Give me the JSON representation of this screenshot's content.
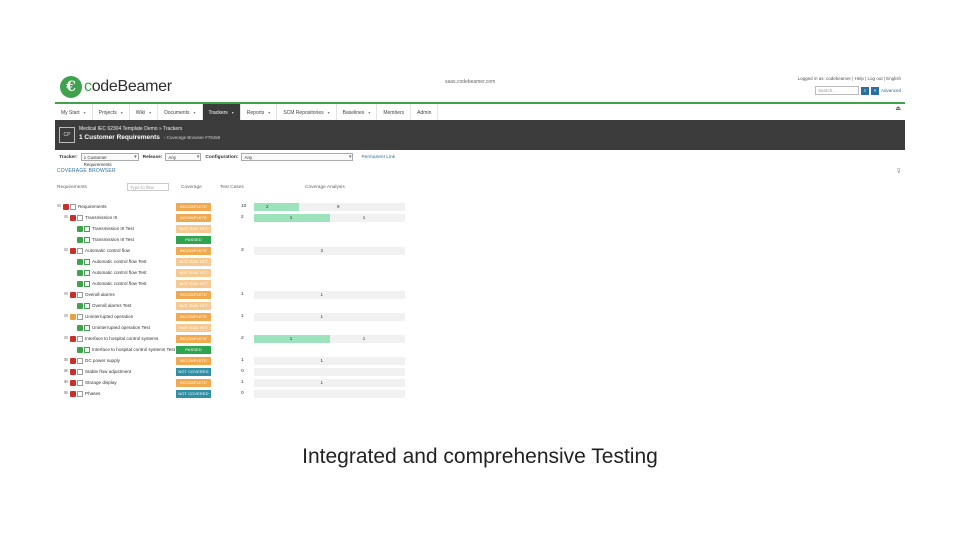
{
  "app": {
    "logo_mark": "€",
    "logo_text_a": "c",
    "logo_text_b": "odeBeamer",
    "server": "saas.codebeamer.com",
    "userlinks": "Logged in as: codebeamer | Help | Log out | English",
    "search_placeholder": "Search...",
    "advanced": "Advanced"
  },
  "nav": {
    "items": [
      {
        "label": "My Start"
      },
      {
        "label": "Projects"
      },
      {
        "label": "Wiki"
      },
      {
        "label": "Documents"
      },
      {
        "label": "Trackers"
      },
      {
        "label": "Reports"
      },
      {
        "label": "SCM Repositories"
      },
      {
        "label": "Baselines"
      },
      {
        "label": "Members"
      },
      {
        "label": "Admin"
      }
    ],
    "active_index": 4,
    "right_icon": "⏏"
  },
  "header": {
    "icon_text": "CP",
    "project": "Medical IEC 62304 Template Demo » Trackers",
    "title": "1 Customer Requirements",
    "subtitle": "› Coverage Browser  #78456"
  },
  "filters": {
    "tracker_label": "Tracker:",
    "tracker_value": "1 Customer Requirements",
    "release_label": "Release:",
    "release_value": "Any",
    "config_label": "Configuration:",
    "config_value": "Any",
    "permanent_link": "Permanent Link"
  },
  "coverage": {
    "title": "COVERAGE BROWSER",
    "filter_icon": "⊽",
    "col_requirements": "Requirements",
    "type_filter_placeholder": "Type to filter",
    "col_coverage": "Coverage",
    "col_test_cases": "Test Cases",
    "col_analysis": "Coverage Analysis"
  },
  "colors": {
    "incomplete": "#f0a94e",
    "not_run_yet": "#f5c98f",
    "passed": "#2fa44f",
    "not_covered": "#2e8fa5",
    "req_red": "#c9302c",
    "req_orange": "#e8a33d",
    "test_green": "#3fa34d"
  },
  "rows": [
    {
      "indent": 0,
      "tree": "⊟",
      "box": "req_red",
      "name": "Requirements",
      "status": "INCOMPLETE",
      "kind": "incomplete",
      "tc": "10",
      "a1": "2",
      "a1w": 0.3,
      "a2": "9",
      "a2x": 0.55,
      "f2w": 0
    },
    {
      "indent": 1,
      "tree": "⊟",
      "box": "req_red",
      "name": "Transmission III",
      "status": "INCOMPLETE",
      "kind": "incomplete",
      "tc": "2",
      "a1": "1",
      "a1w": 0.5,
      "a2": "1",
      "a2x": 0.72,
      "f2w": 0
    },
    {
      "indent": 2,
      "tree": "",
      "box": "test",
      "name": "Transmission III Test",
      "status": "NOT RUN YET",
      "kind": "not_run_yet",
      "tc": "",
      "a1": "",
      "a1w": 0,
      "a2": "",
      "a2x": 0,
      "f2w": 0
    },
    {
      "indent": 2,
      "tree": "",
      "box": "test",
      "name": "Transmission III Test",
      "status": "PASSED",
      "kind": "passed",
      "tc": "",
      "a1": "",
      "a1w": 0,
      "a2": "",
      "a2x": 0,
      "f2w": 0
    },
    {
      "indent": 1,
      "tree": "⊟",
      "box": "req_red",
      "name": "Automatic control flow",
      "status": "INCOMPLETE",
      "kind": "incomplete",
      "tc": "3",
      "a1": "",
      "a1w": 0,
      "a2": "3",
      "a2x": 0.44,
      "f2w": 0
    },
    {
      "indent": 2,
      "tree": "",
      "box": "test",
      "name": "Automatic control flow Test",
      "status": "NOT RUN YET",
      "kind": "not_run_yet",
      "tc": "",
      "a1": "",
      "a1w": 0,
      "a2": "",
      "a2x": 0,
      "f2w": 0
    },
    {
      "indent": 2,
      "tree": "",
      "box": "test",
      "name": "Automatic control flow Test",
      "status": "NOT RUN YET",
      "kind": "not_run_yet",
      "tc": "",
      "a1": "",
      "a1w": 0,
      "a2": "",
      "a2x": 0,
      "f2w": 0
    },
    {
      "indent": 2,
      "tree": "",
      "box": "test",
      "name": "Automatic control flow Test",
      "status": "NOT RUN YET",
      "kind": "not_run_yet",
      "tc": "",
      "a1": "",
      "a1w": 0,
      "a2": "",
      "a2x": 0,
      "f2w": 0
    },
    {
      "indent": 1,
      "tree": "⊟",
      "box": "req_red",
      "name": "Overall alarms",
      "status": "INCOMPLETE",
      "kind": "incomplete",
      "tc": "1",
      "a1": "",
      "a1w": 0,
      "a2": "1",
      "a2x": 0.44,
      "f2w": 0
    },
    {
      "indent": 2,
      "tree": "",
      "box": "test",
      "name": "Overall alarms Test",
      "status": "NOT RUN YET",
      "kind": "not_run_yet",
      "tc": "",
      "a1": "",
      "a1w": 0,
      "a2": "",
      "a2x": 0,
      "f2w": 0
    },
    {
      "indent": 1,
      "tree": "⊟",
      "box": "req_orange",
      "name": "Uninterrupted operation",
      "status": "INCOMPLETE",
      "kind": "incomplete",
      "tc": "1",
      "a1": "",
      "a1w": 0,
      "a2": "1",
      "a2x": 0.44,
      "f2w": 0
    },
    {
      "indent": 2,
      "tree": "",
      "box": "test",
      "name": "Uninterrupted operation Test",
      "status": "NOT RUN YET",
      "kind": "not_run_yet",
      "tc": "",
      "a1": "",
      "a1w": 0,
      "a2": "",
      "a2x": 0,
      "f2w": 0
    },
    {
      "indent": 1,
      "tree": "⊟",
      "box": "req_red",
      "name": "Interface to hospital control systems",
      "status": "INCOMPLETE",
      "kind": "incomplete",
      "tc": "2",
      "a1": "1",
      "a1w": 0.5,
      "a2": "1",
      "a2x": 0.72,
      "f2w": 0
    },
    {
      "indent": 2,
      "tree": "",
      "box": "test",
      "name": "Interface to hospital control systems Test",
      "status": "PASSED",
      "kind": "passed",
      "tc": "",
      "a1": "",
      "a1w": 0,
      "a2": "",
      "a2x": 0,
      "f2w": 0
    },
    {
      "indent": 1,
      "tree": "⊞",
      "box": "req_red",
      "name": "DC power supply",
      "status": "INCOMPLETE",
      "kind": "incomplete",
      "tc": "1",
      "a1": "",
      "a1w": 0,
      "a2": "1",
      "a2x": 0.44,
      "f2w": 0
    },
    {
      "indent": 1,
      "tree": "⊞",
      "box": "req_red",
      "name": "Stable flow adjustment",
      "status": "NOT COVERED",
      "kind": "not_covered",
      "tc": "0",
      "a1": "",
      "a1w": 0,
      "a2": "",
      "a2x": 0,
      "f2w": 0
    },
    {
      "indent": 1,
      "tree": "⊞",
      "box": "req_red",
      "name": "Storage display",
      "status": "INCOMPLETE",
      "kind": "incomplete",
      "tc": "1",
      "a1": "",
      "a1w": 0,
      "a2": "1",
      "a2x": 0.44,
      "f2w": 0
    },
    {
      "indent": 1,
      "tree": "⊞",
      "box": "req_red",
      "name": "Phases",
      "status": "NOT COVERED",
      "kind": "not_covered",
      "tc": "0",
      "a1": "",
      "a1w": 0,
      "a2": "",
      "a2x": 0,
      "f2w": 0
    }
  ],
  "caption": "Integrated and comprehensive Testing"
}
